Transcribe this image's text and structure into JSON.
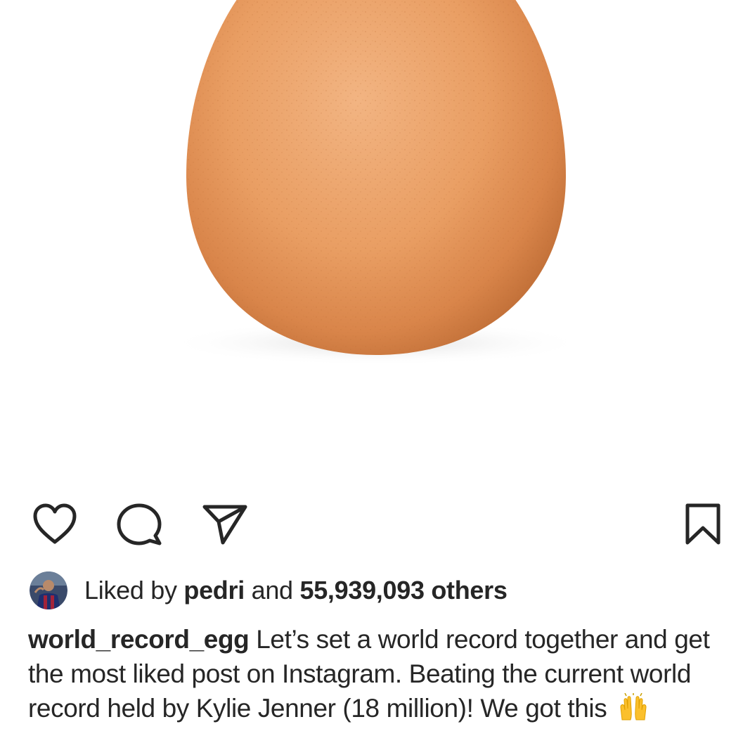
{
  "post": {
    "image_alt": "Brown egg on white background",
    "colors": {
      "egg_light": "#f0b888",
      "egg_main": "#e79d63",
      "egg_dark": "#c8743a",
      "background": "#ffffff",
      "icon_stroke": "#262626"
    }
  },
  "actions": {
    "like_icon": "heart-icon",
    "comment_icon": "speech-bubble-icon",
    "share_icon": "paper-plane-icon",
    "save_icon": "bookmark-icon"
  },
  "likes": {
    "prefix": "Liked by",
    "liker": "pedri",
    "connector": "and",
    "count_text": "55,939,093 others"
  },
  "caption": {
    "username": "world_record_egg",
    "text": "Let’s set a world record together and get the most liked post on Instagram. Beating the current world record held by Kylie Jenner (18 million)! We got this",
    "emoji_icon": "raising-hands-icon"
  }
}
